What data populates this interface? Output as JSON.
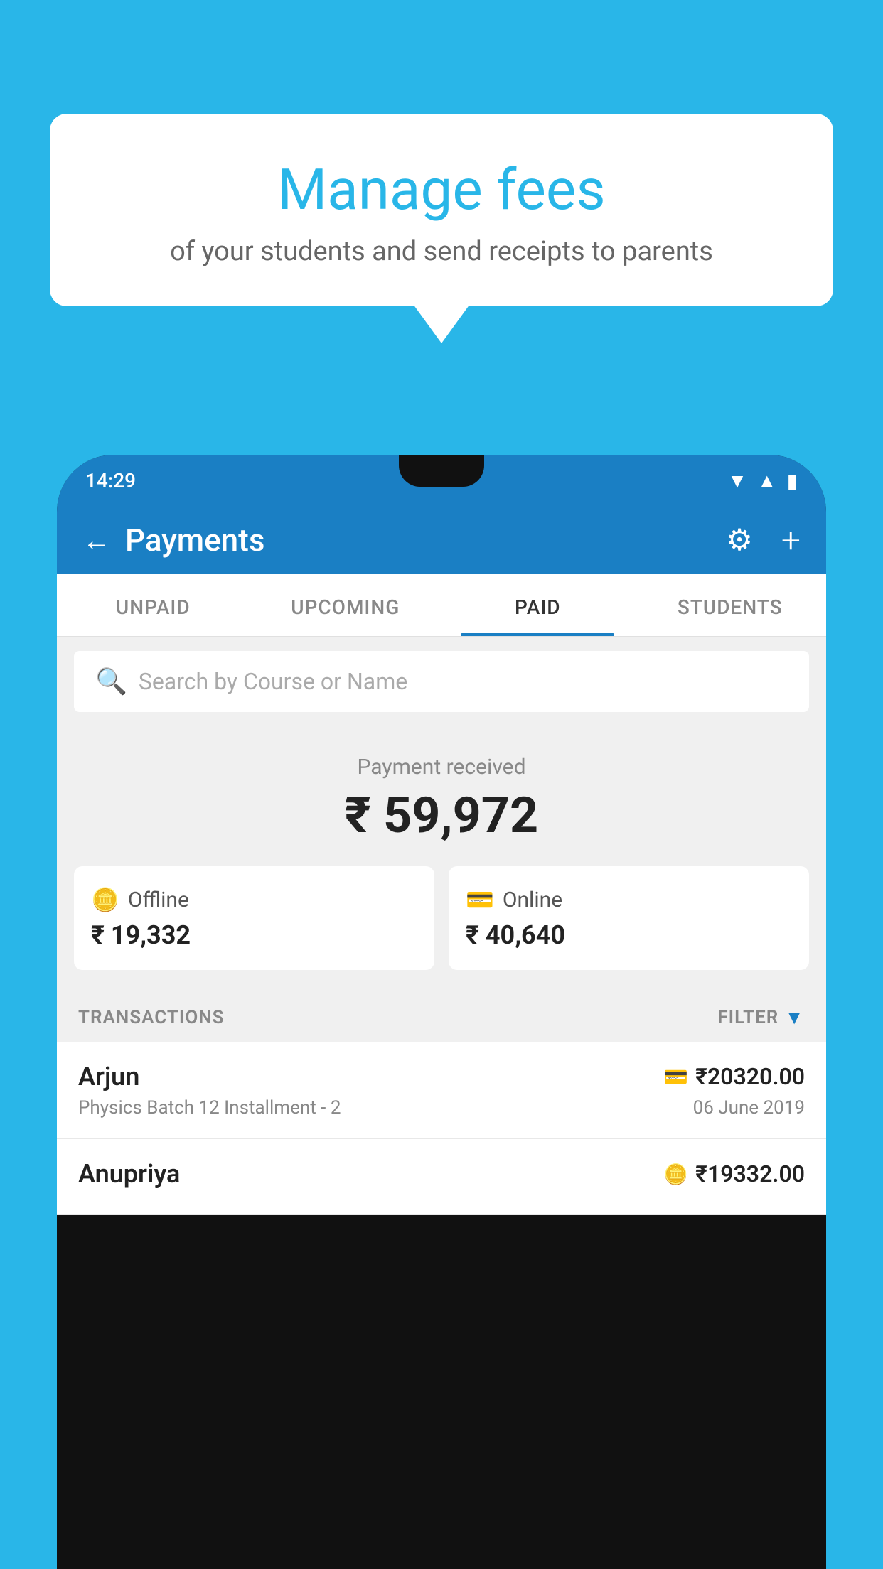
{
  "background_color": "#29b6e8",
  "bubble": {
    "title": "Manage fees",
    "subtitle": "of your students and send receipts to parents"
  },
  "status_bar": {
    "time": "14:29",
    "icons": [
      "wifi",
      "signal",
      "battery"
    ]
  },
  "header": {
    "title": "Payments",
    "back_label": "←",
    "gear_label": "⚙",
    "plus_label": "+"
  },
  "tabs": [
    {
      "label": "UNPAID",
      "active": false
    },
    {
      "label": "UPCOMING",
      "active": false
    },
    {
      "label": "PAID",
      "active": true
    },
    {
      "label": "STUDENTS",
      "active": false
    }
  ],
  "search": {
    "placeholder": "Search by Course or Name"
  },
  "payment_received": {
    "label": "Payment received",
    "amount": "₹ 59,972"
  },
  "cards": [
    {
      "icon": "💳",
      "label": "Offline",
      "amount": "₹ 19,332"
    },
    {
      "icon": "💳",
      "label": "Online",
      "amount": "₹ 40,640"
    }
  ],
  "transactions_label": "TRANSACTIONS",
  "filter_label": "FILTER",
  "transactions": [
    {
      "name": "Arjun",
      "amount": "₹20320.00",
      "amount_icon": "card",
      "course": "Physics Batch 12 Installment - 2",
      "date": "06 June 2019"
    },
    {
      "name": "Anupriya",
      "amount": "₹19332.00",
      "amount_icon": "cash",
      "course": "",
      "date": ""
    }
  ]
}
